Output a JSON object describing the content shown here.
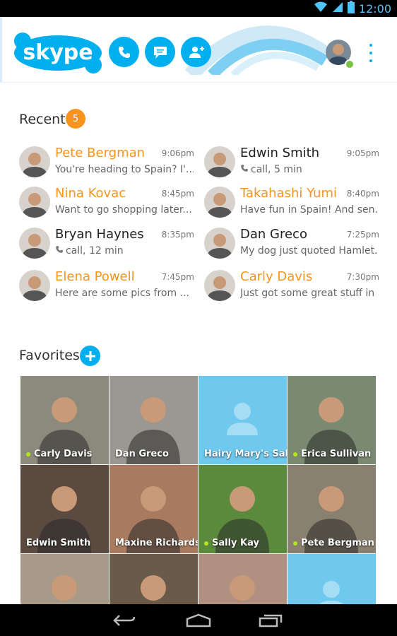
{
  "status_bar": {
    "time": "12:00",
    "icons": [
      "wifi-icon",
      "signal-icon",
      "battery-icon"
    ]
  },
  "header": {
    "logo_text": "skype",
    "buttons": [
      {
        "name": "call-button",
        "icon": "phone-icon"
      },
      {
        "name": "chat-button",
        "icon": "chat-bubble-icon"
      },
      {
        "name": "add-contact-button",
        "icon": "add-person-icon"
      }
    ],
    "user_status": "online",
    "menu_icon": "overflow-menu-icon"
  },
  "recent": {
    "title": "Recent",
    "badge": "5",
    "items": [
      {
        "name": "Pete Bergman",
        "time": "9:06pm",
        "message": "You're heading to Spain? I'...",
        "unread": true,
        "is_call": false,
        "avatar_color": "#5a6b7a"
      },
      {
        "name": "Edwin Smith",
        "time": "9:05pm",
        "message": "call, 5 min",
        "unread": false,
        "is_call": true,
        "avatar_color": "#4a3a30"
      },
      {
        "name": "Nina Kovac",
        "time": "8:45pm",
        "message": "Want to go shopping later...",
        "unread": true,
        "is_call": false,
        "avatar_color": "#6a4a3a"
      },
      {
        "name": "Takahashi Yumi",
        "time": "8:40pm",
        "message": "Have fun in Spain! And sen...",
        "unread": true,
        "is_call": false,
        "avatar_color": "#3a3a3a"
      },
      {
        "name": "Bryan Haynes",
        "time": "8:35pm",
        "message": "call, 12 min",
        "unread": false,
        "is_call": true,
        "avatar_color": "#7a6a5a"
      },
      {
        "name": "Dan Greco",
        "time": "7:25pm",
        "message": "My dog just quoted Hamlet...",
        "unread": false,
        "is_call": false,
        "avatar_color": "#8a8a7a"
      },
      {
        "name": "Elena Powell",
        "time": "7:45pm",
        "message": "Here are some pics from ...",
        "unread": true,
        "is_call": false,
        "avatar_color": "#a07a50"
      },
      {
        "name": "Carly Davis",
        "time": "7:30pm",
        "message": "Just got some great stuff in ...",
        "unread": true,
        "is_call": false,
        "avatar_color": "#6a6a5a"
      }
    ]
  },
  "favorites": {
    "title": "Favorites",
    "tiles": [
      {
        "name": "Carly Davis",
        "online": true,
        "placeholder": false,
        "bg": "#8c8a7c"
      },
      {
        "name": "Dan Greco",
        "online": false,
        "placeholder": false,
        "bg": "#9a9890"
      },
      {
        "name": "Hairy Mary's Sal",
        "online": false,
        "placeholder": true,
        "bg": "#6fc8ee"
      },
      {
        "name": "Erica Sullivan",
        "online": true,
        "placeholder": false,
        "bg": "#7a8a70"
      },
      {
        "name": "Edwin Smith",
        "online": false,
        "placeholder": false,
        "bg": "#5a4a40"
      },
      {
        "name": "Maxine Richards",
        "online": false,
        "placeholder": false,
        "bg": "#a87a60"
      },
      {
        "name": "Sally Kay",
        "online": true,
        "placeholder": false,
        "bg": "#5c8a3c"
      },
      {
        "name": "Pete Bergman",
        "online": true,
        "placeholder": false,
        "bg": "#8a8070"
      },
      {
        "name": "",
        "online": false,
        "placeholder": false,
        "bg": "#a89a88"
      },
      {
        "name": "",
        "online": false,
        "placeholder": false,
        "bg": "#6a5a4a"
      },
      {
        "name": "",
        "online": false,
        "placeholder": false,
        "bg": "#b09080"
      },
      {
        "name": "",
        "online": false,
        "placeholder": true,
        "bg": "#6fc8ee"
      }
    ]
  },
  "nav_bar": {
    "buttons": [
      {
        "name": "back-button",
        "icon": "back-icon"
      },
      {
        "name": "home-button",
        "icon": "home-icon"
      },
      {
        "name": "recent-apps-button",
        "icon": "recent-apps-icon"
      }
    ]
  },
  "colors": {
    "skype_blue": "#00aff0",
    "unread_orange": "#f7941d",
    "online_green": "#7ac143",
    "status_time": "#4fc3f7"
  }
}
